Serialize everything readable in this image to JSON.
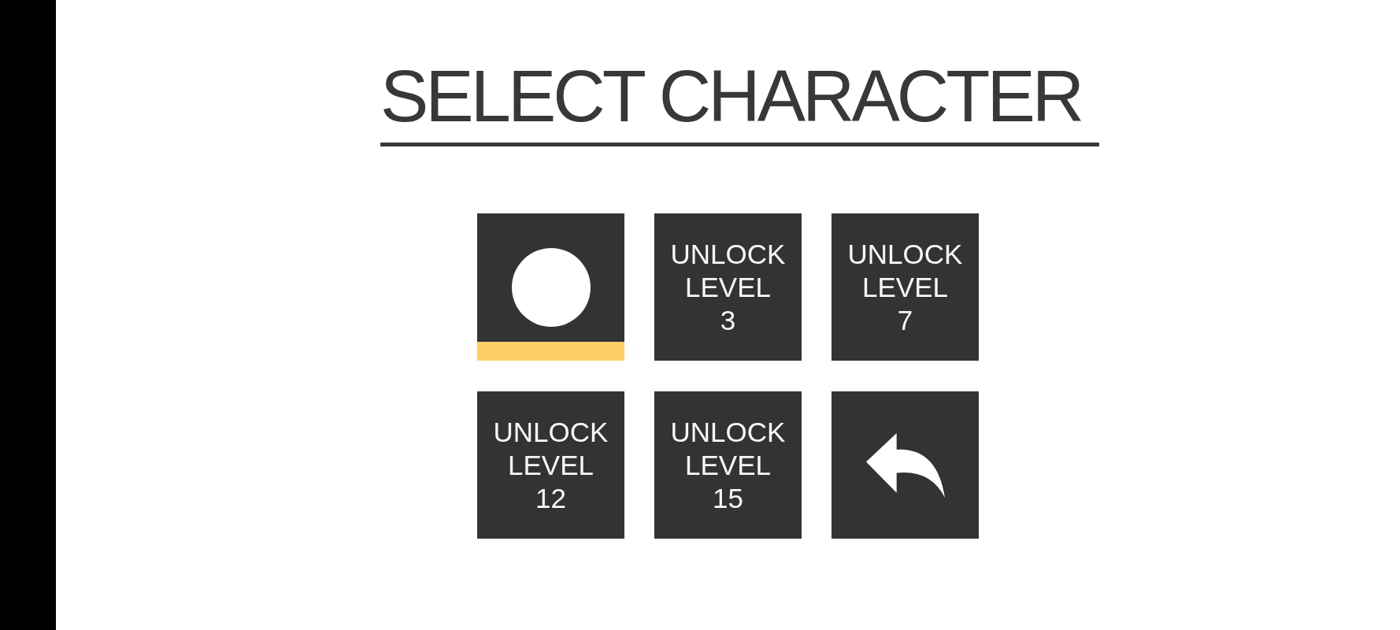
{
  "title": "SELECT CHARACTER",
  "tiles": [
    {
      "kind": "character",
      "selected": true
    },
    {
      "kind": "locked",
      "label": "UNLOCK\nLEVEL\n3",
      "selected": false
    },
    {
      "kind": "locked",
      "label": "UNLOCK\nLEVEL\n7",
      "selected": false
    },
    {
      "kind": "locked",
      "label": "UNLOCK\nLEVEL\n12",
      "selected": false
    },
    {
      "kind": "locked",
      "label": "UNLOCK\nLEVEL\n15",
      "selected": false
    },
    {
      "kind": "back",
      "selected": false
    }
  ]
}
